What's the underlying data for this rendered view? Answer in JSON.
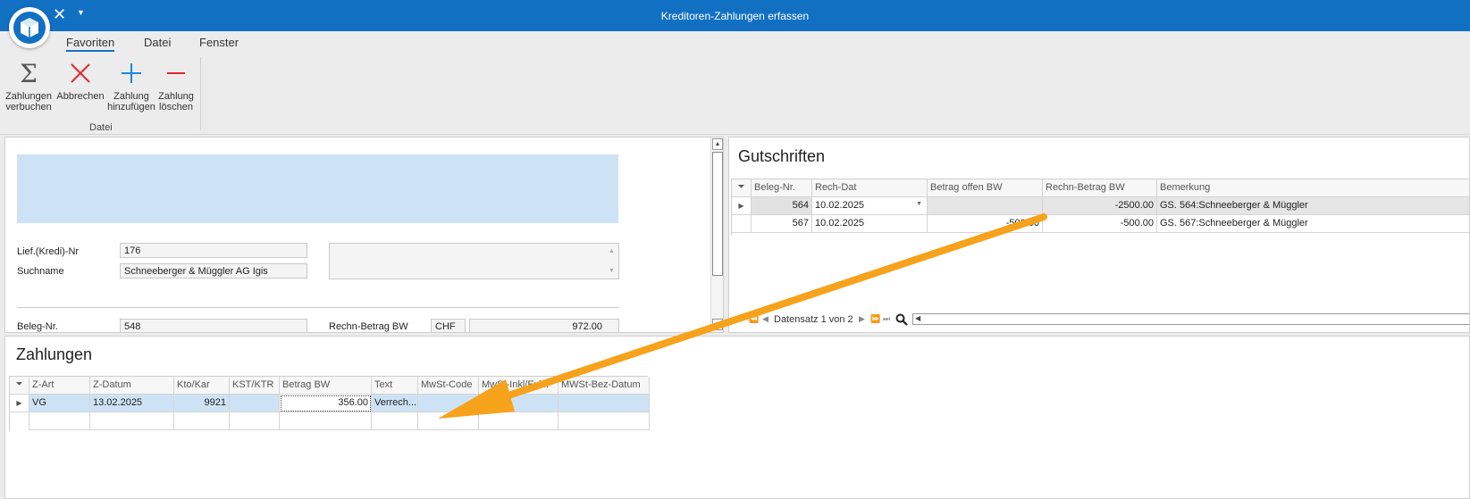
{
  "window": {
    "title": "Kreditoren-Zahlungen erfassen"
  },
  "ribbon": {
    "tabs": [
      "Favoriten",
      "Datei",
      "Fenster"
    ],
    "buttons": {
      "verbuchen": "Zahlungen\nverbuchen",
      "abbrechen": "Abbrechen",
      "hinzufuegen": "Zahlung\nhinzufügen",
      "loeschen": "Zahlung\nlöschen"
    },
    "group_label": "Datei"
  },
  "form": {
    "kredi_label": "Lief.(Kredi)-Nr",
    "kredi_value": "176",
    "suchname_label": "Suchname",
    "suchname_value": "Schneeberger & Müggler AG Igis",
    "beleg_label": "Beleg-Nr.",
    "beleg_value": "548",
    "betrag_label": "Rechn-Betrag BW",
    "currency": "CHF",
    "amount": "972.00"
  },
  "gutschriften": {
    "title": "Gutschriften",
    "columns": [
      "Beleg-Nr.",
      "Rech-Dat",
      "Betrag offen BW",
      "Rechn-Betrag BW",
      "Bemerkung"
    ],
    "rows": [
      [
        "564",
        "10.02.2025",
        "",
        "-2500.00",
        "GS. 564:Schneeberger & Müggler"
      ],
      [
        "567",
        "10.02.2025",
        "-500.00",
        "-500.00",
        "GS. 567:Schneeberger & Müggler"
      ]
    ],
    "nav_text": "Datensatz 1 von 2"
  },
  "zahlungen": {
    "title": "Zahlungen",
    "columns": [
      "Z-Art",
      "Z-Datum",
      "Kto/Kar",
      "KST/KTR",
      "Betrag BW",
      "Text",
      "MwSt-Code",
      "MwSt-Inkl/Exkl.",
      "MWSt-Bez-Datum"
    ],
    "rows": [
      [
        "VG",
        "13.02.2025",
        "9921",
        "",
        "356.00",
        "Verrech...",
        "",
        "",
        ""
      ]
    ]
  },
  "colors": {
    "titlebar": "#1270c3",
    "selection": "#cde3f5",
    "arrow": "#f7a21b"
  }
}
